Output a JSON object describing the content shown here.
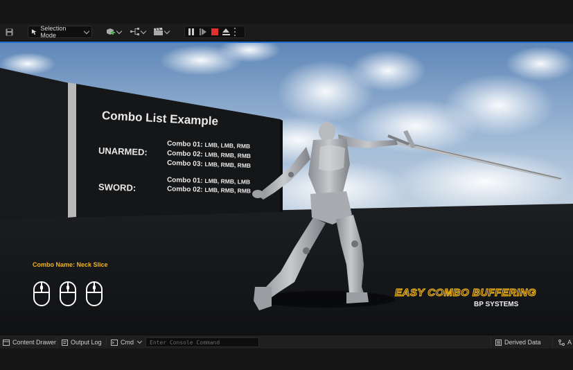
{
  "toolbar": {
    "save_icon": "save-icon",
    "mode_label": "Selection Mode",
    "add_icon": "add-actor-icon",
    "blueprint_icon": "blueprint-icon",
    "cinematics_icon": "clapperboard-icon",
    "play_controls": [
      "pause-icon",
      "step-forward-icon",
      "stop-icon",
      "eject-icon",
      "more-options-icon"
    ],
    "stop_color": "#e0312d"
  },
  "viewport": {
    "wall": {
      "title": "Combo List Example",
      "categories": [
        {
          "name": "UNARMED:",
          "combos": [
            {
              "label": "Combo 01:",
              "inputs": "LMB, LMB, RMB"
            },
            {
              "label": "Combo 02:",
              "inputs": "LMB, RMB, RMB"
            },
            {
              "label": "Combo 03:",
              "inputs": "LMB, RMB, RMB"
            }
          ]
        },
        {
          "name": "SWORD:",
          "combos": [
            {
              "label": "Combo 01:",
              "inputs": "LMB, RMB, LMB"
            },
            {
              "label": "Combo 02:",
              "inputs": "LMB, RMB, RMB"
            }
          ]
        }
      ]
    },
    "hud": {
      "combo_name": "Combo Name: Neck Slice",
      "combo_color": "#f2b51b",
      "mouse_inputs": [
        "mouse-icon",
        "mouse-icon",
        "mouse-icon"
      ]
    },
    "brand": {
      "line1": "EASY COMBO BUFFERING",
      "line2": "BP SYSTEMS",
      "color": "#f0b41a"
    },
    "accent_border": "#1f6fd1"
  },
  "bottombar": {
    "content_drawer": "Content Drawer",
    "output_log": "Output Log",
    "cmd": "Cmd",
    "console_placeholder": "Enter Console Command",
    "derived_data": "Derived Data",
    "truncated": "A"
  }
}
